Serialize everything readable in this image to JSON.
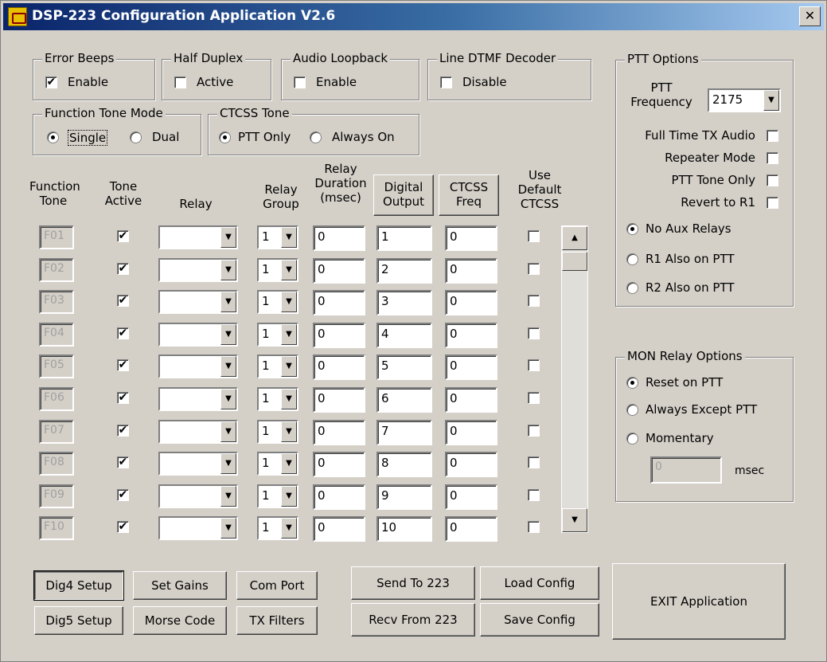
{
  "window": {
    "title": "DSP-223 Configuration Application V2.6",
    "close_glyph": "✕"
  },
  "groups": {
    "error_beeps": {
      "legend": "Error Beeps",
      "label": "Enable",
      "checked": true
    },
    "half_duplex": {
      "legend": "Half Duplex",
      "label": "Active",
      "checked": false
    },
    "audio_loopback": {
      "legend": "Audio Loopback",
      "label": "Enable",
      "checked": false
    },
    "line_dtmf": {
      "legend": "Line DTMF Decoder",
      "label": "Disable",
      "checked": false
    },
    "function_tone_mode": {
      "legend": "Function Tone Mode",
      "options": [
        "Single",
        "Dual"
      ],
      "selected": "Single"
    },
    "ctcss_tone": {
      "legend": "CTCSS Tone",
      "options": [
        "PTT Only",
        "Always On"
      ],
      "selected": "PTT Only"
    }
  },
  "table": {
    "headers": {
      "function_tone": "Function Tone",
      "tone_active": "Tone Active",
      "relay": "Relay",
      "relay_group": "Relay Group",
      "relay_duration": "Relay Duration (msec)",
      "digital_output": "Digital Output",
      "ctcss_freq": "CTCSS Freq",
      "use_default_ctcss": "Use Default CTCSS"
    },
    "rows": [
      {
        "tone": "F01",
        "group": "1",
        "duration": "0",
        "output": "1",
        "ctcss": "0"
      },
      {
        "tone": "F02",
        "group": "1",
        "duration": "0",
        "output": "2",
        "ctcss": "0"
      },
      {
        "tone": "F03",
        "group": "1",
        "duration": "0",
        "output": "3",
        "ctcss": "0"
      },
      {
        "tone": "F04",
        "group": "1",
        "duration": "0",
        "output": "4",
        "ctcss": "0"
      },
      {
        "tone": "F05",
        "group": "1",
        "duration": "0",
        "output": "5",
        "ctcss": "0"
      },
      {
        "tone": "F06",
        "group": "1",
        "duration": "0",
        "output": "6",
        "ctcss": "0"
      },
      {
        "tone": "F07",
        "group": "1",
        "duration": "0",
        "output": "7",
        "ctcss": "0"
      },
      {
        "tone": "F08",
        "group": "1",
        "duration": "0",
        "output": "8",
        "ctcss": "0"
      },
      {
        "tone": "F09",
        "group": "1",
        "duration": "0",
        "output": "9",
        "ctcss": "0"
      },
      {
        "tone": "F10",
        "group": "1",
        "duration": "0",
        "output": "10",
        "ctcss": "0"
      }
    ],
    "check_glyph": "✔"
  },
  "ptt_options": {
    "legend": "PTT Options",
    "frequency_label": "PTT Frequency",
    "frequency_value": "2175",
    "checks": [
      "Full Time TX Audio",
      "Repeater Mode",
      "PTT Tone Only",
      "Revert to R1"
    ],
    "relays": [
      "No Aux Relays",
      "R1 Also on PTT",
      "R2 Also on PTT"
    ],
    "relays_selected": "No Aux Relays"
  },
  "mon_relay": {
    "legend": "MON Relay Options",
    "options": [
      "Reset on PTT",
      "Always Except PTT",
      "Momentary"
    ],
    "selected": "Reset on PTT",
    "momentary_value": "0",
    "unit": "msec"
  },
  "buttons": {
    "dig4_setup": "Dig4 Setup",
    "set_gains": "Set Gains",
    "com_port": "Com Port",
    "dig5_setup": "Dig5 Setup",
    "morse_code": "Morse Code",
    "tx_filters": "TX Filters",
    "send_to_223": "Send To 223",
    "recv_from_223": "Recv From 223",
    "load_config": "Load Config",
    "save_config": "Save Config",
    "exit_application": "EXIT Application"
  }
}
